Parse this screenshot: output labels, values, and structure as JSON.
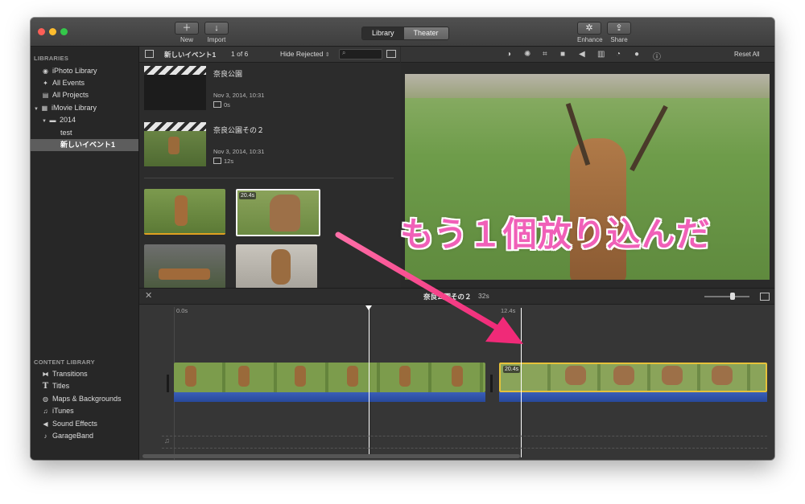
{
  "toolbar": {
    "new_label": "New",
    "import_label": "Import",
    "tabs": [
      {
        "label": "Library"
      },
      {
        "label": "Theater"
      }
    ],
    "enhance_label": "Enhance",
    "share_label": "Share"
  },
  "sidebar": {
    "libraries_header": "LIBRARIES",
    "items": [
      {
        "label": "iPhoto Library",
        "icon": "camera-icon"
      },
      {
        "label": "All Events",
        "icon": "star-icon"
      },
      {
        "label": "All Projects",
        "icon": "clapper-icon"
      },
      {
        "label": "iMovie Library",
        "icon": "grid-icon"
      },
      {
        "label": "2014",
        "icon": "folder-icon"
      },
      {
        "label": "test"
      },
      {
        "label": "新しいイベント1"
      }
    ],
    "content_header": "CONTENT LIBRARY",
    "content_items": [
      {
        "label": "Transitions",
        "icon": "transitions-icon"
      },
      {
        "label": "Titles",
        "icon": "titles-icon"
      },
      {
        "label": "Maps & Backgrounds",
        "icon": "globe-icon"
      },
      {
        "label": "iTunes",
        "icon": "music-note-icon"
      },
      {
        "label": "Sound Effects",
        "icon": "speaker-icon"
      },
      {
        "label": "GarageBand",
        "icon": "guitar-icon"
      }
    ]
  },
  "browser": {
    "event_name": "新しいイベント1",
    "count": "1 of 6",
    "filter": "Hide Rejected",
    "projects": [
      {
        "title": "奈良公園",
        "date": "Nov 3, 2014, 10:31",
        "duration": "0s"
      },
      {
        "title": "奈良公園その２",
        "date": "Nov 3, 2014, 10:31",
        "duration": "12s"
      }
    ],
    "selected_clip_badge": "20.4s"
  },
  "viewer": {
    "reset_label": "Reset All"
  },
  "timeline": {
    "project_title": "奈良公園その２",
    "project_duration": "32s",
    "ruler": [
      "0.0s",
      "12.4s"
    ],
    "second_clip_badge": "20.4s"
  },
  "annotation": {
    "text": "もう１個放り込んだ",
    "color": "#f060b8"
  }
}
